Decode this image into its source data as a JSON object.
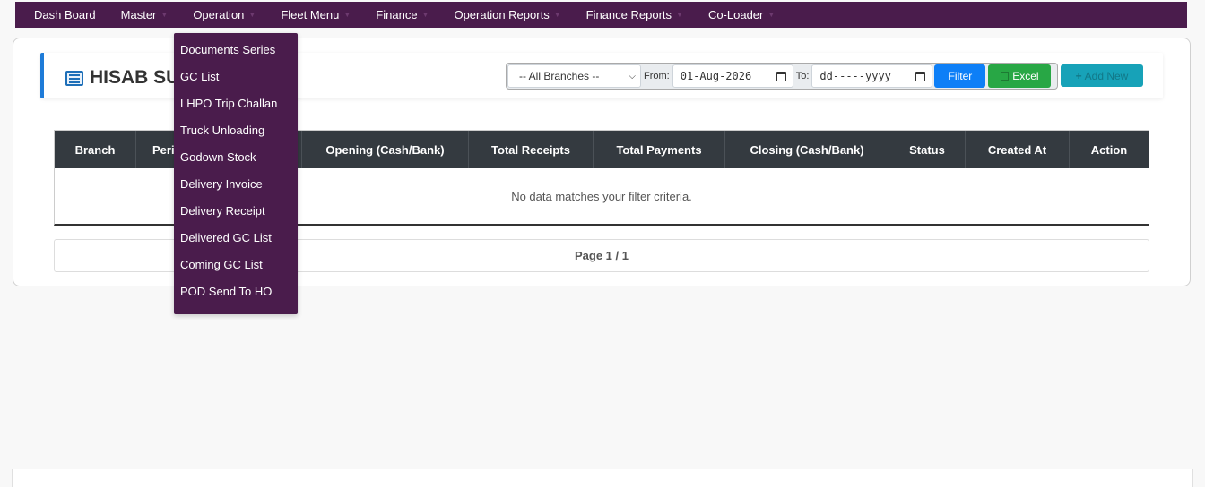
{
  "nav": {
    "items": [
      {
        "label": "Dash Board",
        "caret": false
      },
      {
        "label": "Master",
        "caret": true
      },
      {
        "label": "Operation",
        "caret": true
      },
      {
        "label": "Fleet Menu",
        "caret": true
      },
      {
        "label": "Finance",
        "caret": true
      },
      {
        "label": "Operation Reports",
        "caret": true
      },
      {
        "label": "Finance Reports",
        "caret": true
      },
      {
        "label": "Co-Loader",
        "caret": true
      }
    ]
  },
  "dropdown": {
    "items": [
      "Documents Series",
      "GC List",
      "LHPO Trip Challan",
      "Truck Unloading",
      "Godown Stock",
      "Delivery Invoice",
      "Delivery Receipt",
      "Delivered GC List",
      "Coming GC List",
      "POD Send To HO"
    ]
  },
  "page": {
    "title": "HISAB SU",
    "title_icon": "list-icon"
  },
  "filters": {
    "branch_value": "-- All Branches --",
    "from_label": "From:",
    "from_value": "01-Aug-2026",
    "to_label": "To:",
    "to_value": "dd-----yyyy",
    "filter_label": "Filter",
    "excel_label": "Excel",
    "add_new_label": "Add New"
  },
  "table": {
    "columns": [
      "Branch",
      "Peri",
      "",
      "Opening (Cash/Bank)",
      "Total Receipts",
      "Total Payments",
      "Closing (Cash/Bank)",
      "Status",
      "Created At",
      "Action"
    ],
    "empty_message": "No data matches your filter criteria."
  },
  "pager": {
    "text": "Page 1 / 1"
  },
  "colors": {
    "navbar": "#4a1c4c",
    "accent_blue": "#0d7ff7",
    "excel_green": "#28a745",
    "add_new_teal": "#17a2b8",
    "table_header": "#343a40"
  }
}
